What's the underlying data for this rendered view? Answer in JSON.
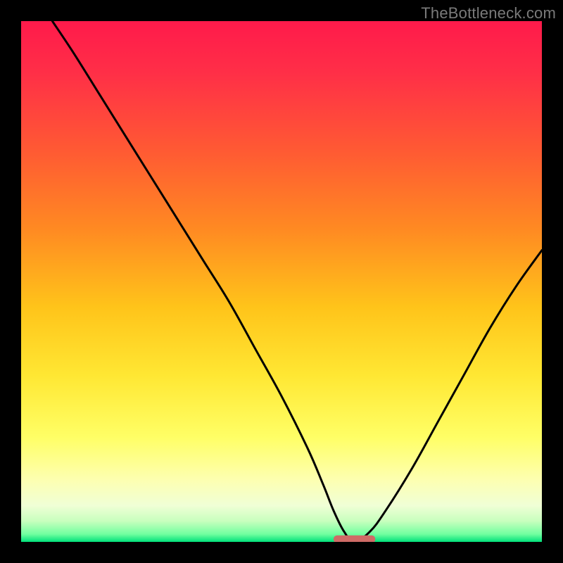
{
  "watermark": "TheBottleneck.com",
  "chart_data": {
    "type": "line",
    "title": "",
    "xlabel": "",
    "ylabel": "",
    "xlim": [
      0,
      100
    ],
    "ylim": [
      0,
      100
    ],
    "gradient_stops": [
      {
        "offset": 0.0,
        "color": "#ff1a4b"
      },
      {
        "offset": 0.1,
        "color": "#ff2f47"
      },
      {
        "offset": 0.25,
        "color": "#ff5a33"
      },
      {
        "offset": 0.4,
        "color": "#ff8a22"
      },
      {
        "offset": 0.55,
        "color": "#ffc41a"
      },
      {
        "offset": 0.68,
        "color": "#ffe733"
      },
      {
        "offset": 0.8,
        "color": "#ffff66"
      },
      {
        "offset": 0.88,
        "color": "#fdffb0"
      },
      {
        "offset": 0.93,
        "color": "#f0ffd6"
      },
      {
        "offset": 0.96,
        "color": "#c8ffbe"
      },
      {
        "offset": 0.985,
        "color": "#72ffa0"
      },
      {
        "offset": 1.0,
        "color": "#00e07a"
      }
    ],
    "series": [
      {
        "name": "bottleneck-curve",
        "type": "line",
        "color": "#000000",
        "x": [
          6,
          10,
          15,
          20,
          25,
          30,
          35,
          40,
          45,
          50,
          55,
          58,
          60,
          62,
          64,
          67,
          70,
          75,
          80,
          85,
          90,
          95,
          100
        ],
        "y": [
          100,
          94,
          86,
          78,
          70,
          62,
          54,
          46,
          37,
          28,
          18,
          11,
          6,
          2,
          0,
          2,
          6,
          14,
          23,
          32,
          41,
          49,
          56
        ]
      }
    ],
    "bottom_marker": {
      "x_start": 60,
      "x_end": 68,
      "y": 0.5,
      "color": "#cf6b66"
    }
  }
}
